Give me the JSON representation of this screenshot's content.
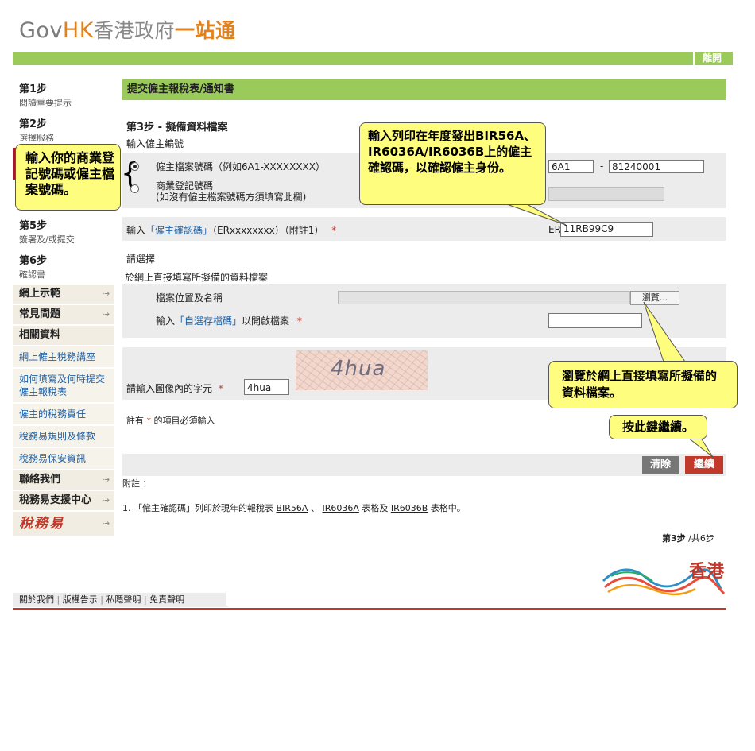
{
  "header": {
    "logo_gov": "Gov",
    "logo_hk": "HK",
    "logo_cn": "香港政府",
    "logo_one": "一站通",
    "exit_label": "離開"
  },
  "sidebar": {
    "steps": [
      {
        "title": "第1步",
        "sub": "閱讀重要提示"
      },
      {
        "title": "第2步",
        "sub": "選擇服務"
      },
      {
        "title": "第5步",
        "sub": "簽署及/或提交"
      },
      {
        "title": "第6步",
        "sub": "確認書"
      }
    ],
    "nav": {
      "demo": "網上示範",
      "faq": "常見問題",
      "related": "相關資料",
      "links": [
        "網上僱主稅務講座",
        "如何填寫及何時提交僱主報稅表",
        "僱主的稅務責任",
        "稅務易規則及條款",
        "稅務易保安資訊"
      ],
      "contact": "聯絡我們",
      "support": "稅務易支援中心",
      "tax_logo": "稅務易"
    }
  },
  "main": {
    "title": "提交僱主報稅表/通知書",
    "step_heading": "第3步 - 擬備資料檔案",
    "employer_no_label": "輸入僱主編號",
    "option_file_label": "僱主檔案號碼（例如6A1-XXXXXXXX）",
    "option_br_label": "商業登記號碼",
    "option_br_note": "(如沒有僱主檔案號碼方須填寫此欄)",
    "file_no_prefix": "6A1",
    "file_no_dash": "-",
    "file_no_number": "81240001",
    "er_label_pre": "輸入",
    "er_label_link": "「僱主確認碼」",
    "er_label_post": "（ERxxxxxxxx）（附註1）",
    "required_mark": "*",
    "er_prefix": "ER",
    "er_value": "11RB99C9",
    "choose_label": "請選擇",
    "online_file_label": "於網上直接填寫所擬備的資料檔案",
    "file_location_label": "檔案位置及名稱",
    "browse_label": "瀏覽...",
    "password_label_pre": "輸入",
    "password_label_link": "「自選存檔碼」",
    "password_label_post": "以開啟檔案",
    "captcha_text": "4hua",
    "captcha_label": "請輸入圖像內的字元",
    "captcha_value": "4hua",
    "required_note_pre": "註有",
    "required_note_post": "的項目必須輸入",
    "clear_label": "清除",
    "next_label": "繼續",
    "notes_title": "附註 ：",
    "note1_pre": "1. 「僱主確認碼」列印於現年的報稅表",
    "note1_form1": "BIR56A",
    "note1_sep": "、",
    "note1_form2": "IR6036A",
    "note1_mid": "表格及",
    "note1_form3": "IR6036B",
    "note1_post": "表格中。",
    "step_count_bold": "第3步",
    "step_count_rest": "/共6步"
  },
  "callouts": {
    "left": "輸入你的商業登記號碼或僱主檔案號碼。",
    "top": "輸入列印在年度發出BIR56A、IR6036A/IR6036B上的僱主確認碼，以確認僱主身份。",
    "browse": "瀏覽於網上直接填寫所擬備的資料檔案。",
    "next": "按此鍵繼續。"
  },
  "footer": {
    "links": [
      "關於我們",
      "版權告示",
      "私隱聲明",
      "免責聲明"
    ],
    "separator": "|",
    "brand": "香港"
  },
  "colors": {
    "green_bar": "#9acb5a",
    "accent_red": "#c0392b",
    "callout_yellow": "#fffd7d",
    "link_blue": "#1f5fa3"
  }
}
